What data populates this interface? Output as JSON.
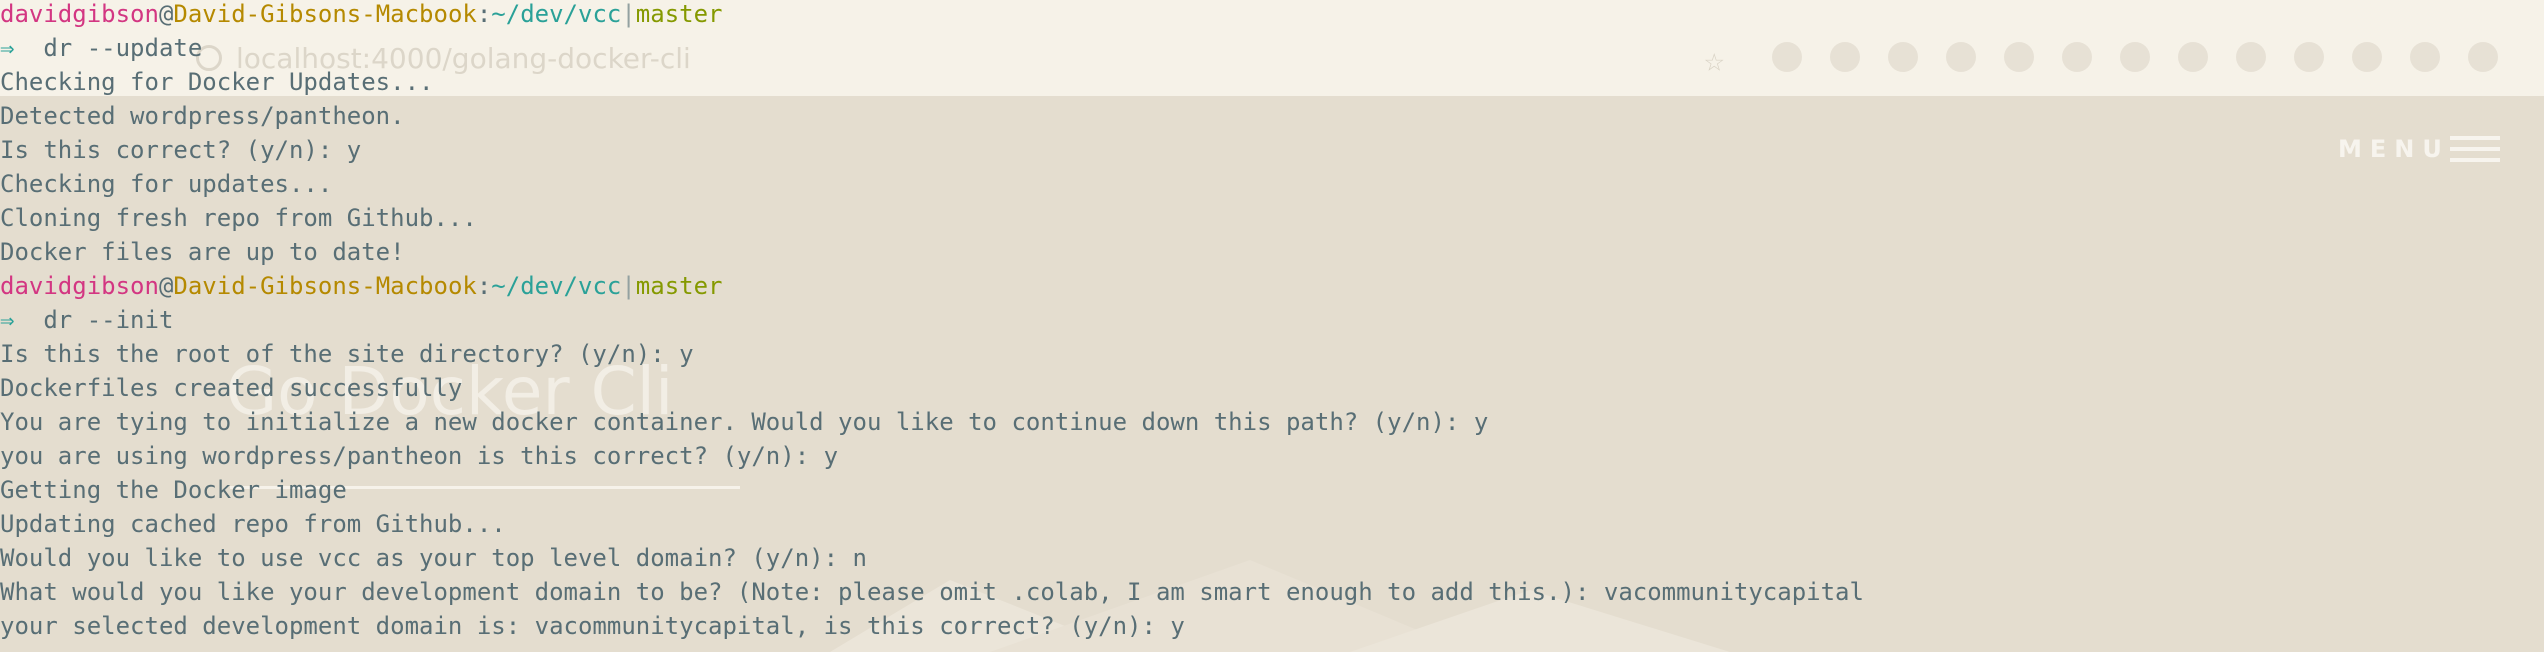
{
  "browser": {
    "url": "localhost:4000/golang-docker-cli",
    "menu_label": "MENU",
    "page_heading": "Go Docker Cli"
  },
  "prompt_1": {
    "user": "davidgibson",
    "at": "@",
    "host": "David-Gibsons-Macbook",
    "sep": ":",
    "path": "~/dev/vcc",
    "bar": "|",
    "branch": "master"
  },
  "command_1": {
    "arrow": "⇒",
    "text": "  dr --update"
  },
  "output_1": [
    "Checking for Docker Updates...",
    "Detected wordpress/pantheon.",
    "Is this correct? (y/n): y",
    "Checking for updates...",
    "Cloning fresh repo from Github...",
    "Docker files are up to date!"
  ],
  "prompt_2": {
    "user": "davidgibson",
    "at": "@",
    "host": "David-Gibsons-Macbook",
    "sep": ":",
    "path": "~/dev/vcc",
    "bar": "|",
    "branch": "master"
  },
  "command_2": {
    "arrow": "⇒",
    "text": "  dr --init"
  },
  "output_2": [
    "Is this the root of the site directory? (y/n): y",
    "Dockerfiles created successfully",
    "You are tying to initialize a new docker container. Would you like to continue down this path? (y/n): y",
    "you are using wordpress/pantheon is this correct? (y/n): y",
    "Getting the Docker image",
    "Updating cached repo from Github...",
    "Would you like to use vcc as your top level domain? (y/n): n",
    "What would you like your development domain to be? (Note: please omit .colab, I am smart enough to add this.): vacommunitycapital",
    "your selected development domain is: vacommunitycapital, is this correct? (y/n): y"
  ],
  "colors": {
    "background": "#ece7dc",
    "text": "#586e75",
    "user": "#d33682",
    "host": "#b58900",
    "path": "#2aa198",
    "branch": "#859900"
  }
}
